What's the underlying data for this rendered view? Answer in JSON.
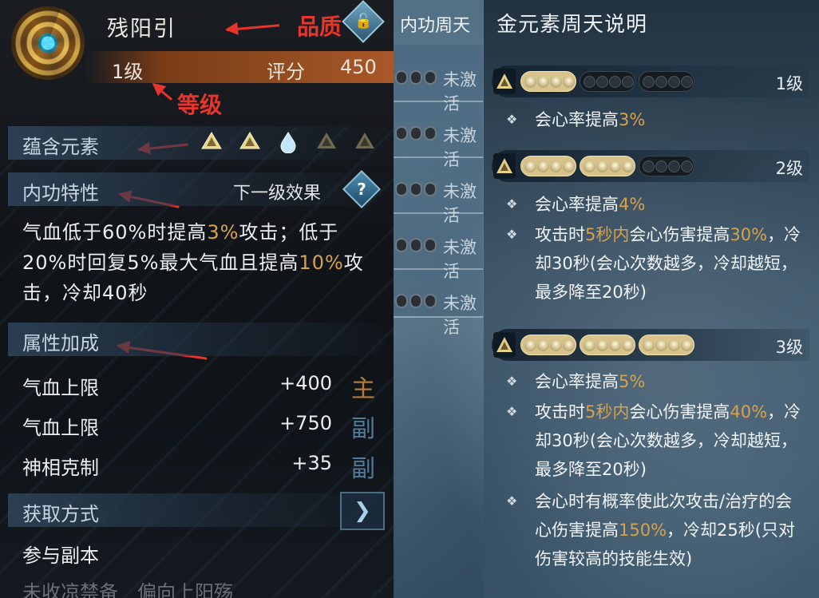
{
  "left_panel": {
    "item_name": "残阳引",
    "lock_glyph": "🔓",
    "level": "1级",
    "score_label": "评分",
    "score_value": "450",
    "annotations": {
      "quality": "品质",
      "grade": "等级"
    },
    "elements": {
      "title": "蕴含元素",
      "icons": [
        "gold-triangle-active",
        "gold-triangle-active",
        "water-drop",
        "gold-triangle-dim",
        "gold-triangle-dim"
      ]
    },
    "trait": {
      "title": "内功特性",
      "next_label": "下一级效果",
      "help_glyph": "?",
      "desc_parts": [
        "气血低于60%时提高",
        "3%",
        "攻击；低于20%时回复5%最大气血且提高",
        "10%",
        "攻击，冷却40秒"
      ]
    },
    "attributes": {
      "title": "属性加成",
      "rows": [
        {
          "name": "气血上限",
          "value": "+400",
          "tag": "主"
        },
        {
          "name": "气血上限",
          "value": "+750",
          "tag": "副"
        },
        {
          "name": "神相克制",
          "value": "+35",
          "tag": "副"
        }
      ]
    },
    "source": {
      "title": "获取方式",
      "button_glyph": "❯",
      "text": "参与副本",
      "text_partial": "未收凉禁备　偏向上阳殇"
    },
    "colors": {
      "highlight": "#d6a24e",
      "annotation": "#e8352b"
    }
  },
  "right_panel": {
    "tab_title": "内功周天",
    "tab_rows": [
      "未激活",
      "未激活",
      "未激活",
      "未激活",
      "未激活"
    ],
    "info_title": "金元素周天说明",
    "levels": [
      {
        "label": "1级",
        "pills": [
          "on",
          "off",
          "off"
        ],
        "bullets": [
          {
            "parts": [
              "会心率提高",
              "3%"
            ]
          }
        ]
      },
      {
        "label": "2级",
        "pills": [
          "on",
          "on",
          "off"
        ],
        "bullets": [
          {
            "parts": [
              "会心率提高",
              "4%"
            ]
          },
          {
            "parts": [
              "攻击时",
              "5秒内",
              "会心伤害提高",
              "30%",
              "，冷却30秒(会心次数越多，冷却越短，最多降至20秒)"
            ]
          }
        ]
      },
      {
        "label": "3级",
        "pills": [
          "on",
          "on",
          "on"
        ],
        "bullets": [
          {
            "parts": [
              "会心率提高",
              "5%"
            ]
          },
          {
            "parts": [
              "攻击时",
              "5秒内",
              "会心伤害提高",
              "40%",
              "，冷却30秒(会心次数越多，冷却越短，最多降至20秒)"
            ]
          },
          {
            "parts": [
              "会心时有概率使此次攻击/治疗的会心伤害提高",
              "150%",
              "，冷却25秒(只对伤害较高的技能生效)"
            ]
          }
        ]
      }
    ]
  }
}
